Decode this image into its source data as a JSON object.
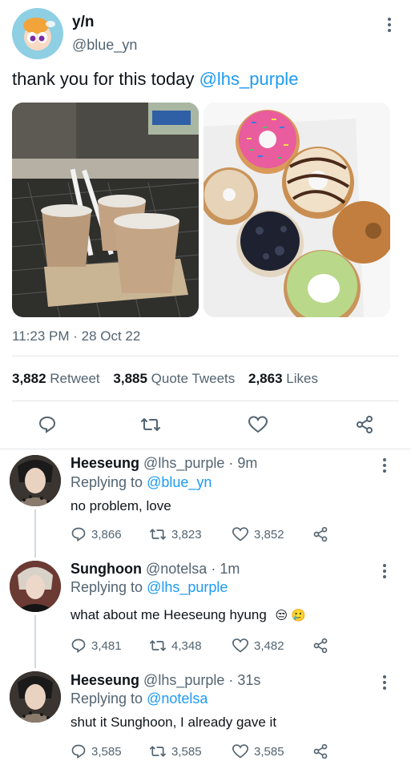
{
  "tweet": {
    "display_name": "y/n",
    "handle": "@blue_yn",
    "text_prefix": "thank you for this today ",
    "text_mention": "@lhs_purple",
    "timestamp": "11:23 PM · 28 Oct 22",
    "stats": {
      "retweets": "3,882",
      "retweets_label": "Retweet",
      "quotes": "3,885",
      "quotes_label": "Quote Tweets",
      "likes": "2,863",
      "likes_label": "Likes"
    }
  },
  "replies": [
    {
      "name": "Heeseung",
      "handle": "@lhs_purple",
      "time": "· 9m",
      "replying_label": "Replying to",
      "replying_to": "@blue_yn",
      "text": "no problem, love",
      "replies": "3,866",
      "retweets": "3,823",
      "likes": "3,852"
    },
    {
      "name": "Sunghoon",
      "handle": "@notelsa",
      "time": "· 1m",
      "replying_label": "Replying to",
      "replying_to": "@lhs_purple",
      "text": "what about me Heeseung hyung",
      "emoji": "😒 🥲",
      "replies": "3,481",
      "retweets": "4,348",
      "likes": "3,482"
    },
    {
      "name": "Heeseung",
      "handle": "@lhs_purple",
      "time": "· 31s",
      "replying_label": "Replying to",
      "replying_to": "@notelsa",
      "text": "shut it Sunghoon, I already gave it",
      "replies": "3,585",
      "retweets": "3,585",
      "likes": "3,585"
    }
  ],
  "colors": {
    "accent": "#1d9bf0",
    "secondary_text": "#536471",
    "divider": "#e1e5e8"
  }
}
